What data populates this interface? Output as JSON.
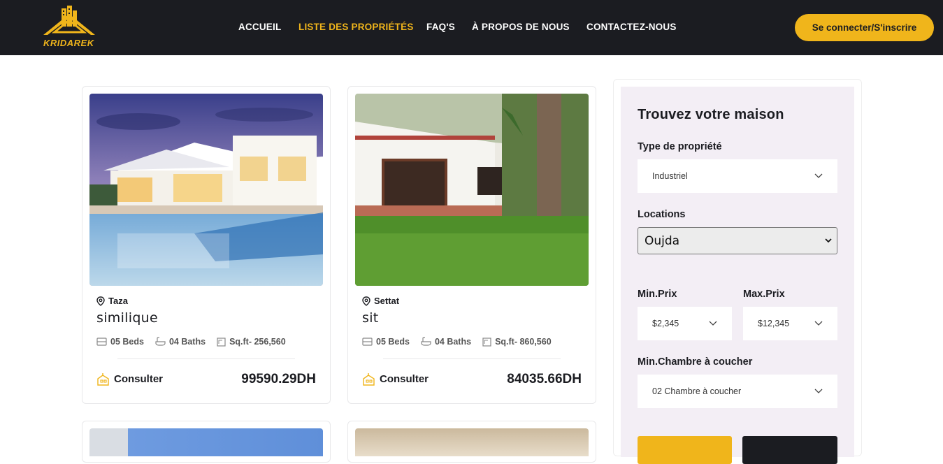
{
  "brand": {
    "name": "KRIDAREK",
    "accent": "#f0b51b",
    "dark": "#1b1c21"
  },
  "nav": {
    "items": [
      {
        "label": "ACCUEIL"
      },
      {
        "label": "LISTE DES PROPRIÉTÉS"
      },
      {
        "label": "FAQ'S"
      },
      {
        "label": "À PROPOS DE NOUS"
      },
      {
        "label": "CONTACTEZ-NOUS"
      }
    ],
    "active_index": 1,
    "login_label": "Se connecter/S'inscrire"
  },
  "listings": [
    {
      "location": "Taza",
      "title": "similique",
      "beds": "05 Beds",
      "baths": "04 Baths",
      "area": "Sq.ft- 256,560",
      "consult_label": "Consulter",
      "price": "99590.29DH"
    },
    {
      "location": "Settat",
      "title": "sit",
      "beds": "05 Beds",
      "baths": "04 Baths",
      "area": "Sq.ft- 860,560",
      "consult_label": "Consulter",
      "price": "84035.66DH"
    }
  ],
  "search": {
    "heading": "Trouvez votre maison",
    "type_label": "Type de propriété",
    "type_value": "Industriel",
    "locations_label": "Locations",
    "locations_value": "Oujda",
    "min_price_label": "Min.Prix",
    "min_price_value": "$2,345",
    "max_price_label": "Max.Prix",
    "max_price_value": "$12,345",
    "bedrooms_label": "Min.Chambre à coucher",
    "bedrooms_value": "02 Chambre à coucher"
  },
  "icons": [
    "logo-house-icon",
    "map-pin-icon",
    "bed-icon",
    "bath-icon",
    "area-icon",
    "building-icon",
    "chevron-down-icon"
  ]
}
